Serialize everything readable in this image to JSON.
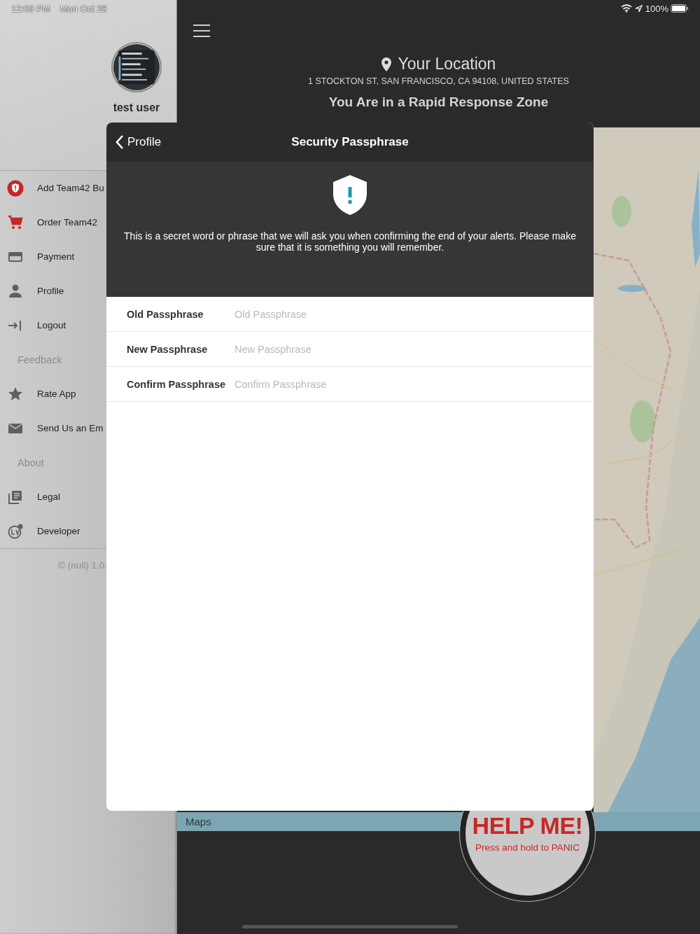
{
  "status_bar": {
    "time": "12:09 PM",
    "date": "Mon Oct 28",
    "battery": "100%"
  },
  "sidebar": {
    "user_name": "test user",
    "items": [
      {
        "kind": "item",
        "label": "Add Team42 Bu"
      },
      {
        "kind": "item",
        "label": "Order Team42"
      },
      {
        "kind": "item",
        "label": "Payment"
      },
      {
        "kind": "item",
        "label": "Profile"
      },
      {
        "kind": "item",
        "label": "Logout"
      },
      {
        "kind": "header",
        "label": "Feedback"
      },
      {
        "kind": "item",
        "label": "Rate App"
      },
      {
        "kind": "item",
        "label": "Send Us an Em"
      },
      {
        "kind": "header",
        "label": "About"
      },
      {
        "kind": "item",
        "label": "Legal"
      },
      {
        "kind": "item",
        "label": "Developer"
      }
    ],
    "footer": "© (null) 1.0."
  },
  "location": {
    "title": "Your Location",
    "address": "1 STOCKTON ST, SAN FRANCISCO, CA  94108, UNITED STATES",
    "zone": "You Are in a Rapid Response Zone"
  },
  "map": {
    "attribution": "Maps"
  },
  "modal": {
    "back": "Profile",
    "title": "Security Passphrase",
    "description": "This is a secret word or phrase that we will ask you when confirming the end of your alerts. Please make sure that it is something you will remember.",
    "fields": [
      {
        "label": "Old Passphrase",
        "placeholder": "Old Passphrase"
      },
      {
        "label": "New Passphrase",
        "placeholder": "New Passphrase"
      },
      {
        "label": "Confirm Passphrase",
        "placeholder": "Confirm Passphrase"
      }
    ]
  },
  "help_button": {
    "title": "HELP ME!",
    "subtitle": "Press and hold to PANIC"
  }
}
